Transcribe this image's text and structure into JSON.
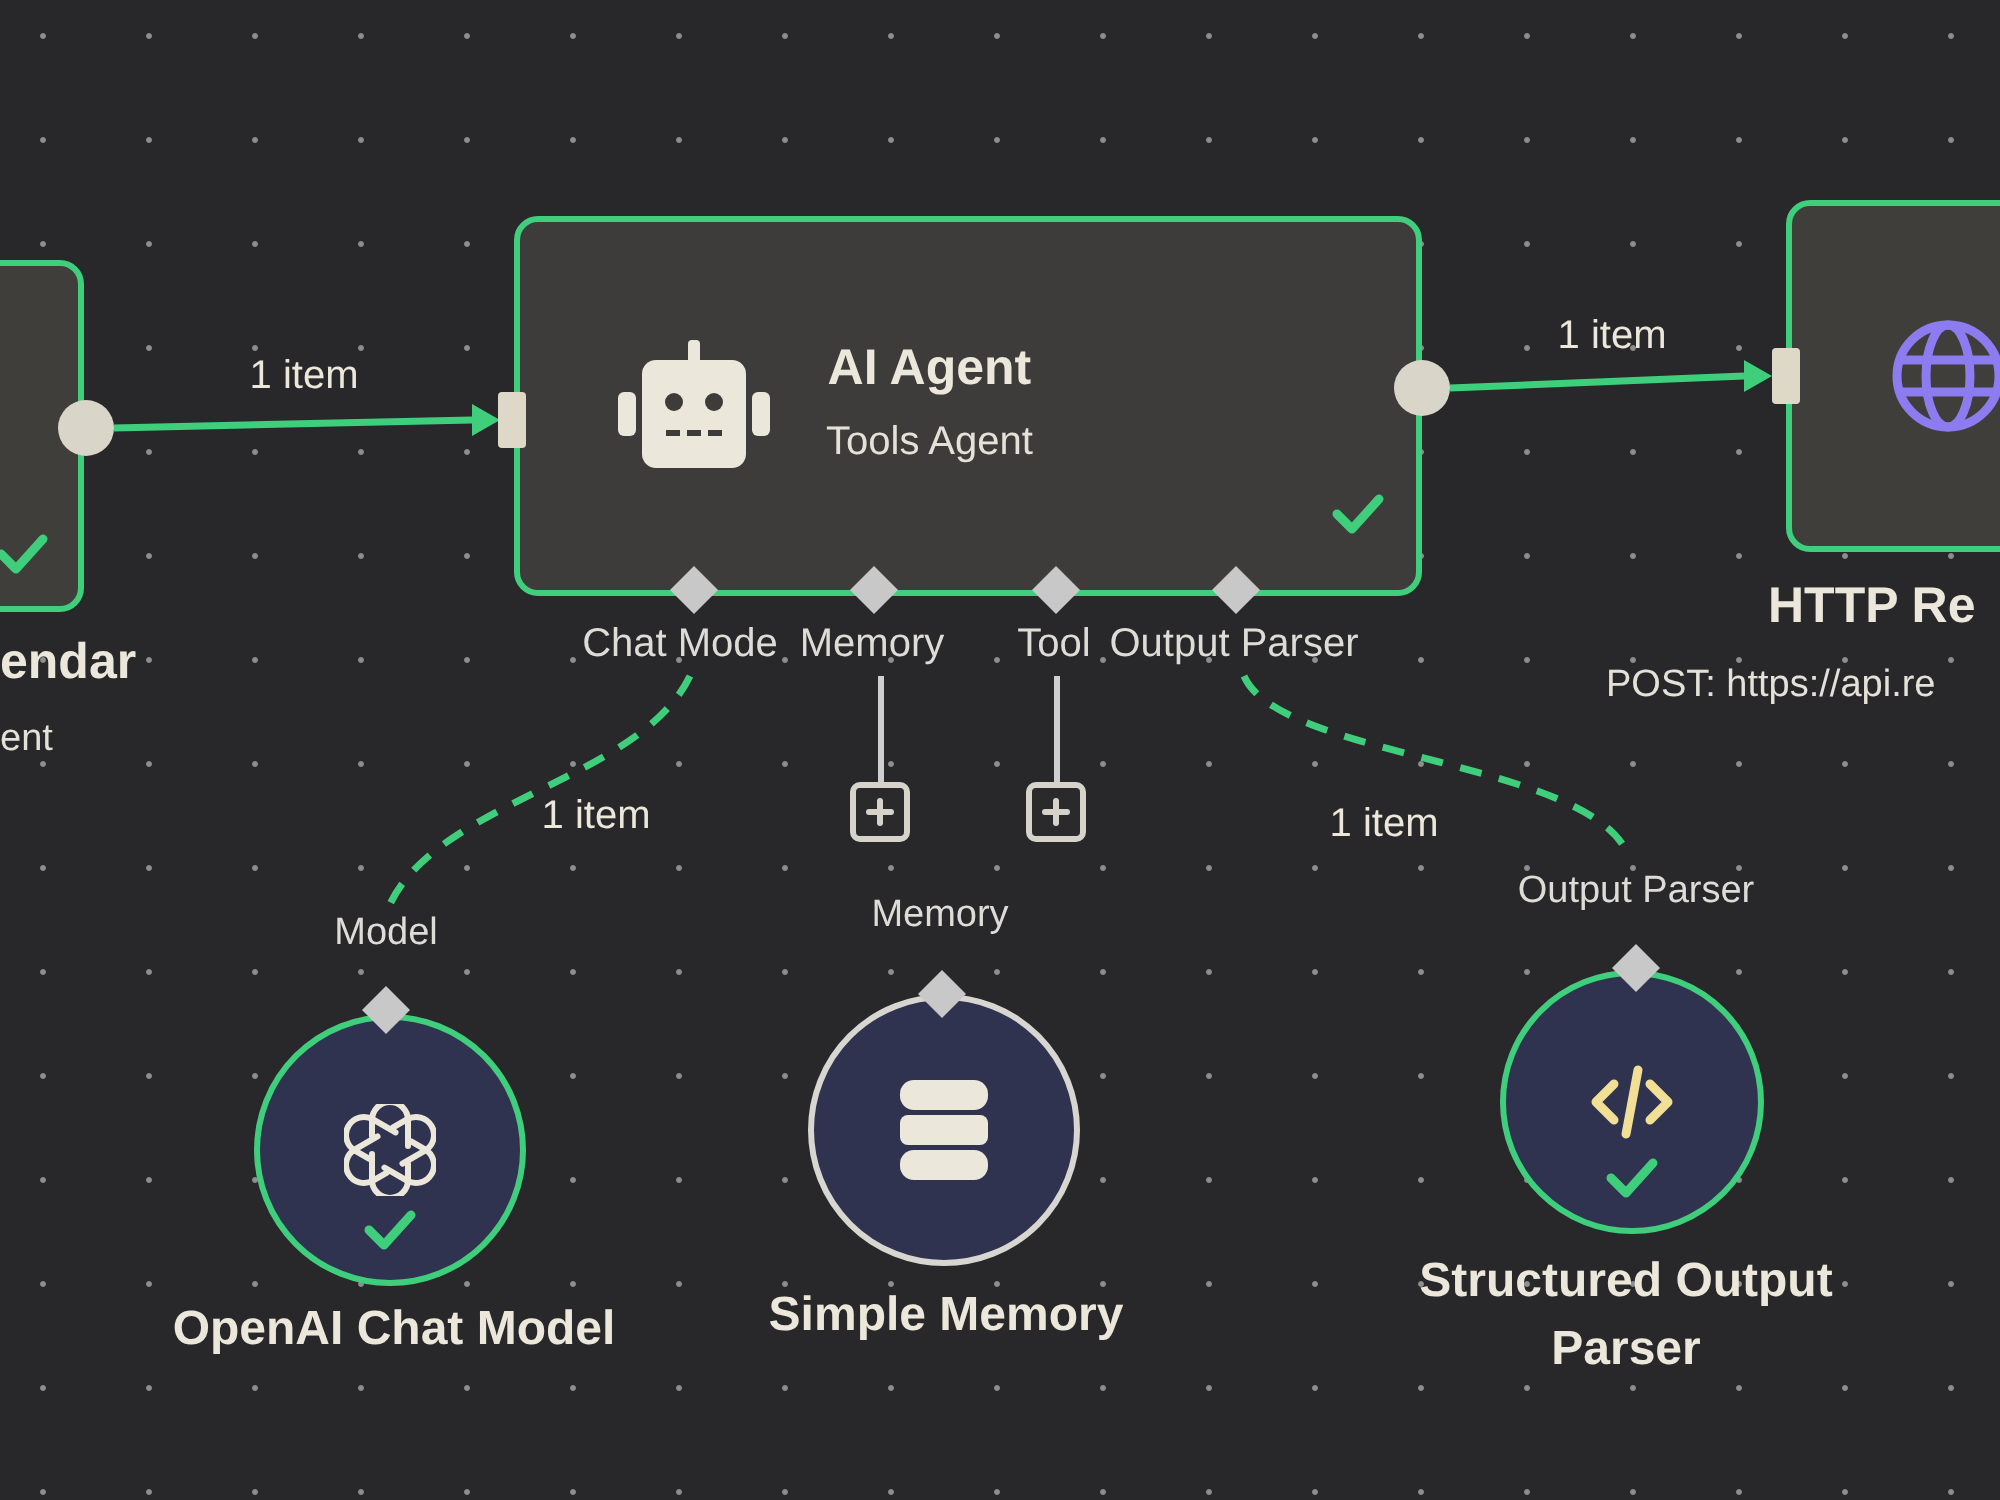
{
  "canvas": {
    "nodes": [
      {
        "kind": "square",
        "title": "endar",
        "subtitle": "ent",
        "success": true
      },
      {
        "kind": "wide",
        "title": "AI Agent",
        "subtitle": "Tools Agent",
        "success": true,
        "ports": [
          {
            "label": "Chat Mode",
            "connected": true,
            "edge_label": "1 item"
          },
          {
            "label": "Memory",
            "connected": false
          },
          {
            "label": "Tool",
            "connected": false
          },
          {
            "label": "Output Parser",
            "connected": true,
            "edge_label": "1 item"
          }
        ]
      },
      {
        "kind": "square",
        "title": "HTTP Re",
        "subtitle": "POST: https://api.re",
        "success": true
      },
      {
        "kind": "circle",
        "port_label": "Model",
        "title": "OpenAI Chat Model",
        "success": true
      },
      {
        "kind": "circle",
        "port_label": "Memory",
        "title": "Simple Memory",
        "success": false
      },
      {
        "kind": "circle",
        "port_label": "Output Parser",
        "title": "Structured Output Parser",
        "success": true
      }
    ],
    "connections": [
      {
        "kind": "main",
        "label": "1 item"
      },
      {
        "kind": "main",
        "label": "1 item"
      }
    ]
  }
}
